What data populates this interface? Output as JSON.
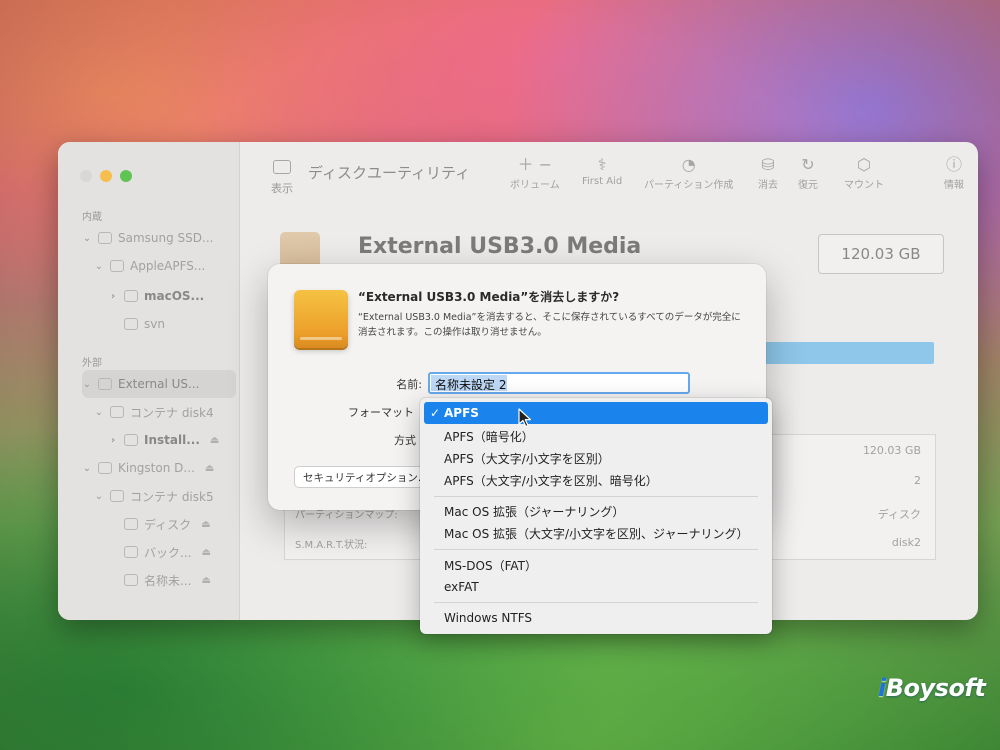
{
  "window": {
    "title": "ディスクユーティリティ",
    "toolbar": {
      "view_label": "表示",
      "volume_label": "ボリューム",
      "first_aid_label": "First Aid",
      "partition_label": "パーティション作成",
      "erase_label": "消去",
      "restore_label": "復元",
      "mount_label": "マウント",
      "info_label": "情報"
    }
  },
  "sidebar": {
    "internal_header": "内蔵",
    "external_header": "外部",
    "items": [
      {
        "label": "Samsung SSD..."
      },
      {
        "label": "AppleAPFS..."
      },
      {
        "label": "macOS..."
      },
      {
        "label": "svn"
      },
      {
        "label": "External US..."
      },
      {
        "label": "コンテナ disk4"
      },
      {
        "label": "Install..."
      },
      {
        "label": "Kingston D..."
      },
      {
        "label": "コンテナ disk5"
      },
      {
        "label": "ディスク"
      },
      {
        "label": "バック..."
      },
      {
        "label": "名称未..."
      }
    ]
  },
  "drive": {
    "name": "External USB3.0 Media",
    "capacity": "120.03 GB"
  },
  "info_table": {
    "rows": [
      {
        "value": "120.03 GB"
      },
      {
        "value": "2"
      },
      {
        "key": "パーティションマップ:",
        "value": "ディスク"
      },
      {
        "key": "S.M.A.R.T.状況:",
        "value": "disk2"
      }
    ]
  },
  "dialog": {
    "title": "“External USB3.0 Media”を消去しますか?",
    "message": "“External USB3.0 Media”を消去すると、そこに保存されているすべてのデータが完全に消去されます。この操作は取り消せません。",
    "name_label": "名前:",
    "name_value": "名称未設定 2",
    "format_label": "フォーマット",
    "scheme_label": "方式",
    "security_button": "セキュリティオプション..."
  },
  "format_menu": {
    "selected_index": 0,
    "check_glyph": "✓",
    "items": [
      "APFS",
      "APFS（暗号化）",
      "APFS（大文字/小文字を区別）",
      "APFS（大文字/小文字を区別、暗号化）",
      "Mac OS 拡張（ジャーナリング）",
      "Mac OS 拡張（大文字/小文字を区別、ジャーナリング）",
      "MS-DOS（FAT）",
      "exFAT",
      "Windows NTFS"
    ]
  },
  "watermark": {
    "prefix": "i",
    "brand": "Boysoft"
  },
  "colors": {
    "accent": "#1a84ec",
    "selection_light": "#bcd8f5"
  }
}
